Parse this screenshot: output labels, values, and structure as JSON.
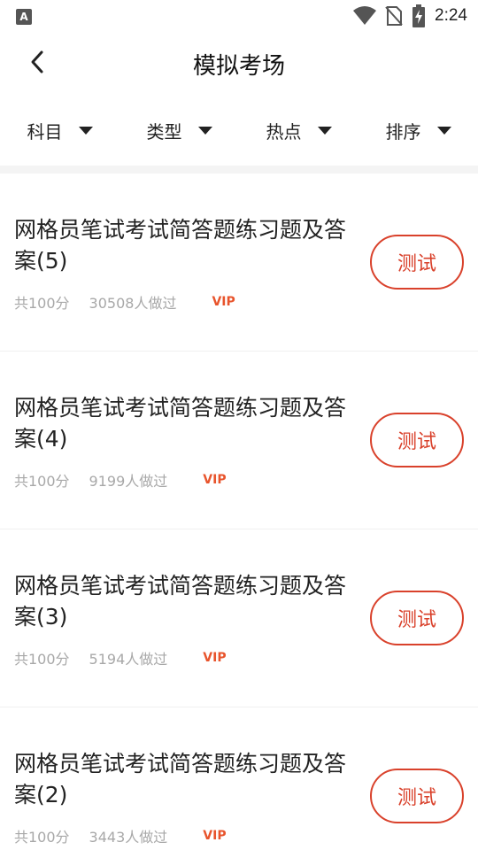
{
  "status_bar": {
    "left_icon": "A",
    "icons": [
      "wifi-icon",
      "no-sim-icon",
      "battery-charging-icon"
    ],
    "time": "2:24"
  },
  "header": {
    "title": "模拟考场"
  },
  "filters": [
    {
      "label": "科目"
    },
    {
      "label": "类型"
    },
    {
      "label": "热点"
    },
    {
      "label": "排序"
    }
  ],
  "exams": [
    {
      "title": "网格员笔试考试简答题练习题及答案(5)",
      "score": "共100分",
      "count": "30508人做过",
      "badge": "VIP",
      "action": "测试"
    },
    {
      "title": "网格员笔试考试简答题练习题及答案(4)",
      "score": "共100分",
      "count": "9199人做过",
      "badge": "VIP",
      "action": "测试"
    },
    {
      "title": "网格员笔试考试简答题练习题及答案(3)",
      "score": "共100分",
      "count": "5194人做过",
      "badge": "VIP",
      "action": "测试"
    },
    {
      "title": "网格员笔试考试简答题练习题及答案(2)",
      "score": "共100分",
      "count": "3443人做过",
      "badge": "VIP",
      "action": "测试"
    }
  ],
  "colors": {
    "accent": "#d9412b",
    "vip": "#e8542c",
    "meta_text": "#a8a8a8"
  }
}
